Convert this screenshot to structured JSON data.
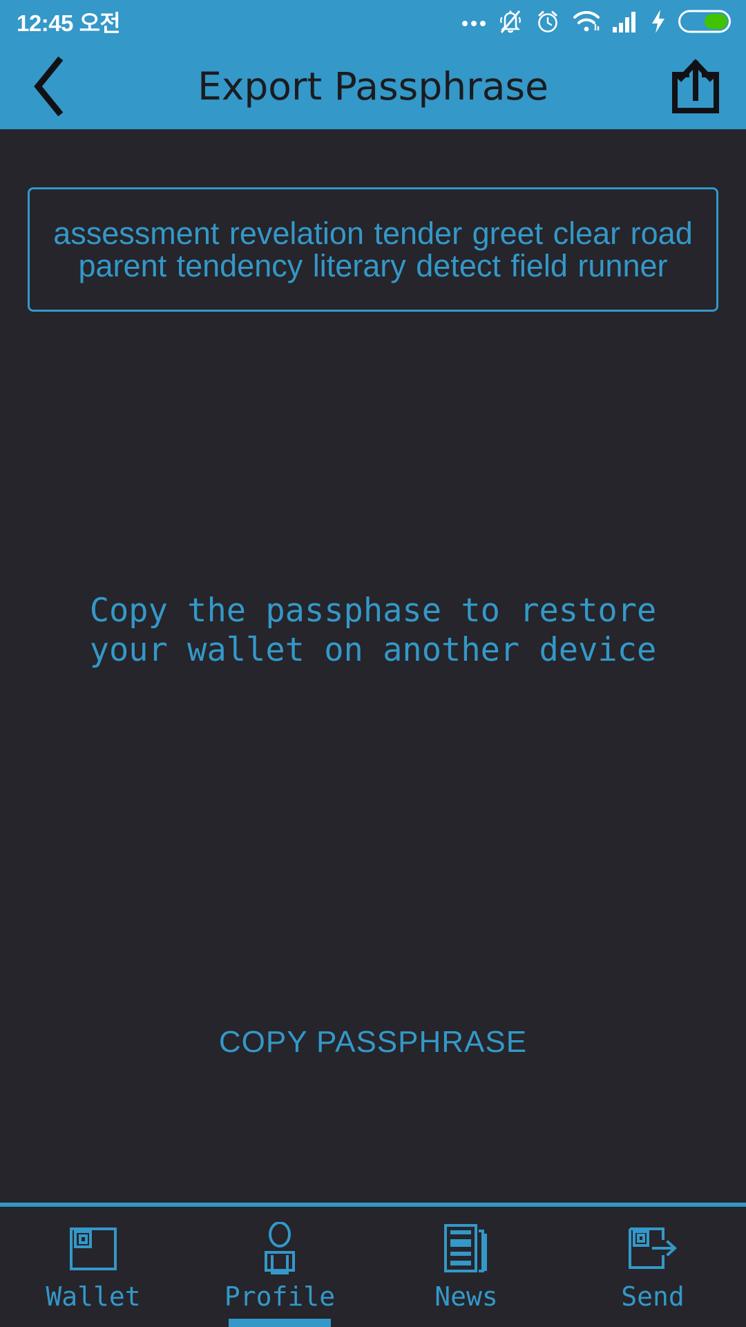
{
  "status_bar": {
    "time": "12:45 오전",
    "icons": [
      {
        "name": "more-dots-icon",
        "label": "more"
      },
      {
        "name": "bell-muted-icon",
        "label": "silent"
      },
      {
        "name": "alarm-clock-icon",
        "label": "alarm"
      },
      {
        "name": "wifi-icon",
        "label": "wifi"
      },
      {
        "name": "signal-bars-icon",
        "label": "signal"
      },
      {
        "name": "charging-bolt-icon",
        "label": "charging"
      },
      {
        "name": "battery-icon",
        "label": "battery"
      }
    ],
    "battery_color": "#41c300",
    "background_color": "#3498c8",
    "text_color": "#ffffff"
  },
  "header": {
    "title": "Export Passphrase",
    "back_icon": "chevron-left-icon",
    "share_icon": "share-export-icon",
    "background_color": "#3498c8",
    "title_color": "#1b1b1f"
  },
  "main": {
    "passphrase": "assessment revelation tender greet clear road parent tendency literary detect field runner",
    "passphrase_words": [
      "assessment",
      "revelation",
      "tender",
      "greet",
      "clear",
      "road",
      "parent",
      "tendency",
      "literary",
      "detect",
      "field",
      "runner"
    ],
    "hint": "Copy the passphase to restore\nyour wallet on another device",
    "copy_button_label": "COPY PASSPHRASE",
    "accent_color": "#3498c8",
    "background_color": "#25252b"
  },
  "bottom_nav": {
    "active_index": 1,
    "items": [
      {
        "label": "Wallet",
        "icon": "wallet-icon"
      },
      {
        "label": "Profile",
        "icon": "person-icon"
      },
      {
        "label": "News",
        "icon": "newspaper-icon"
      },
      {
        "label": "Send",
        "icon": "wallet-arrow-icon"
      }
    ],
    "accent_color": "#3498c8"
  }
}
